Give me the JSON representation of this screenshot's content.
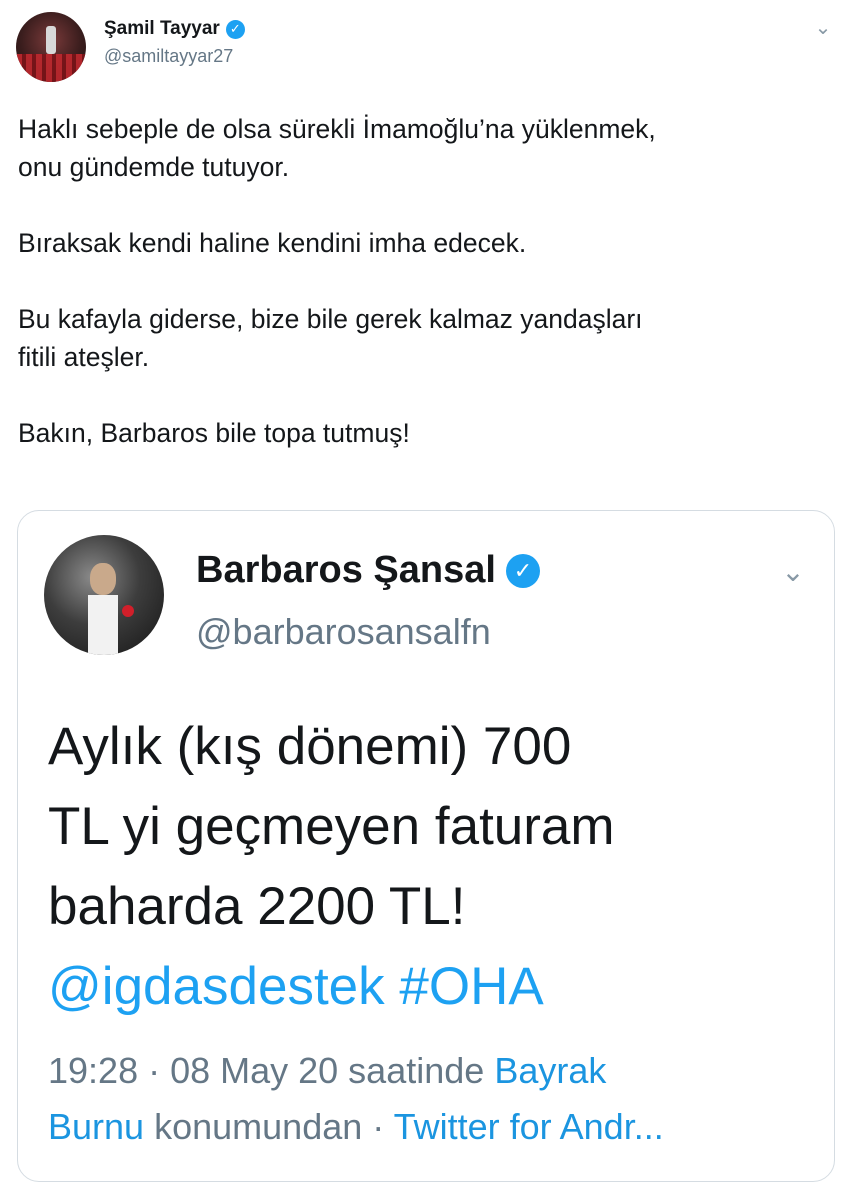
{
  "author": {
    "display_name": "Şamil Tayyar",
    "handle": "@samiltayyar27",
    "verified_glyph": "✓"
  },
  "tweet": {
    "paragraphs": [
      "Haklı sebeple de olsa sürekli İmamoğlu’na yüklenmek,\nonu gündemde tutuyor.",
      "Bıraksak kendi haline kendini imha edecek.",
      "Bu kafayla giderse, bize bile gerek kalmaz yandaşları\nfitili ateşler.",
      "Bakın, Barbaros bile topa tutmuş!"
    ]
  },
  "quoted_tweet": {
    "display_name": "Barbaros Şansal",
    "handle": "@barbarosansalfn",
    "verified_glyph": "✓",
    "text": "Aylık (kış dönemi) 700\nTL yi geçmeyen faturam\nbaharda 2200 TL!",
    "mention": "@igdasdestek",
    "hashtag": "#OHA",
    "time": "19:28 · 08 May 20 saatinde",
    "location": "Bayrak\nBurnu",
    "location_suffix": "konumundan ·",
    "source": "Twitter for Andr..."
  },
  "icons": {
    "caret": "chevron-down-icon",
    "verified": "verified-badge-icon"
  },
  "colors": {
    "link": "#1da1f2",
    "secondary_text": "#657786",
    "verified": "#1da1f2"
  }
}
